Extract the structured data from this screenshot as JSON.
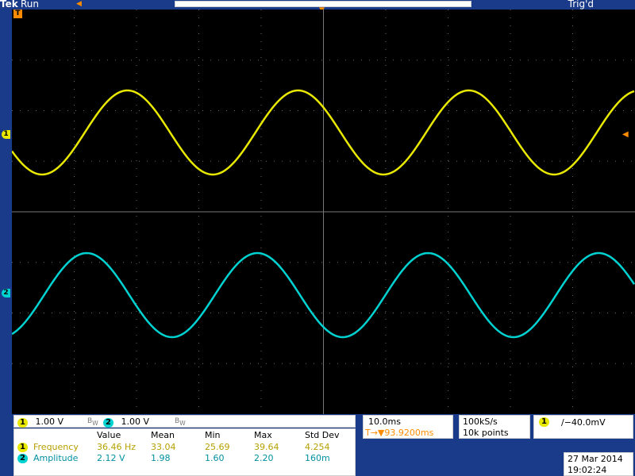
{
  "status": {
    "brand": "Tek",
    "state": "Run",
    "trigger_state": "Trig'd"
  },
  "channels": [
    {
      "id": "1",
      "scale": "1.00 V",
      "color": "#e8e800",
      "marker": "1"
    },
    {
      "id": "2",
      "scale": "1.00 V",
      "color": "#00d2d2",
      "marker": "2"
    }
  ],
  "trigger_marker": "T",
  "bandwidth_icon": "bw-limit-icon",
  "measurements": {
    "headers": [
      "Value",
      "Mean",
      "Min",
      "Max",
      "Std Dev"
    ],
    "rows": [
      {
        "channel": "1",
        "label": "Frequency",
        "value": "36.46 Hz",
        "mean": "33.04",
        "min": "25.69",
        "max": "39.64",
        "std": "4.254"
      },
      {
        "channel": "2",
        "label": "Amplitude",
        "value": "2.12 V",
        "mean": "1.98",
        "min": "1.60",
        "max": "2.20",
        "std": "160m"
      }
    ]
  },
  "horizontal": {
    "time_per_div": "10.0ms",
    "trigger_position": "T→▼93.9200ms"
  },
  "acquisition": {
    "sample_rate": "100kS/s",
    "record_length": "10k points"
  },
  "trigger": {
    "channel": "1",
    "level": "∕−40.0mV"
  },
  "datetime": {
    "date": "27 Mar  2014",
    "time": "19:02:24"
  }
}
